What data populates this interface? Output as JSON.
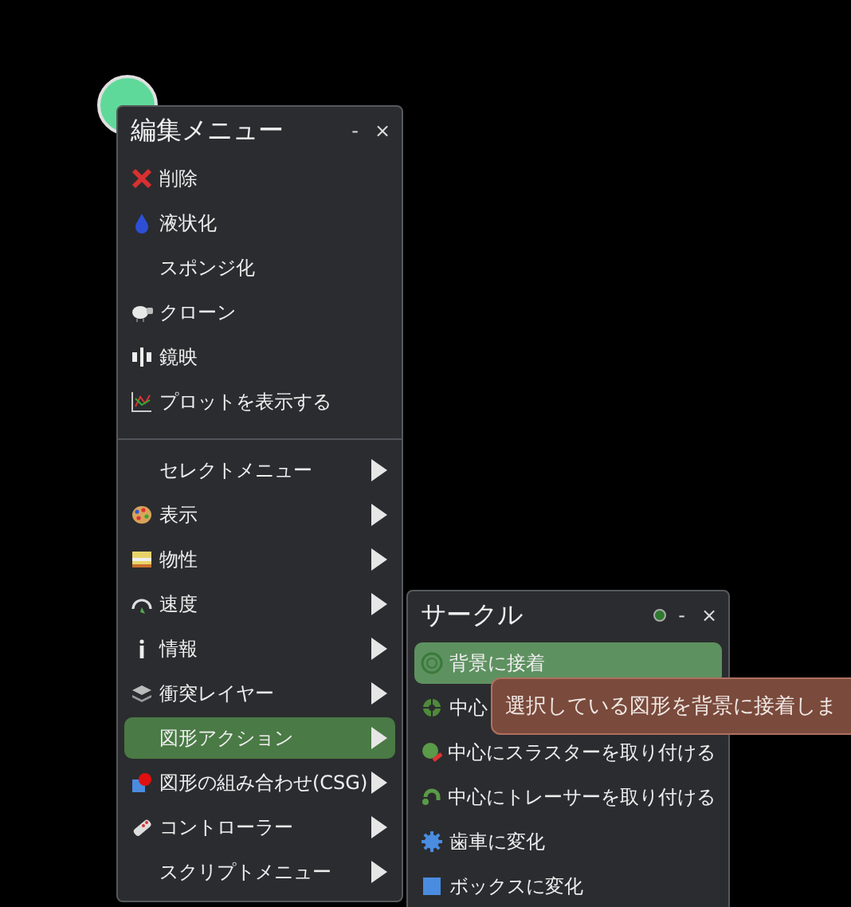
{
  "edit_menu": {
    "title": "編集メニュー",
    "title_buttons": [
      "-",
      "×"
    ],
    "items": [
      {
        "kind": "action",
        "label": "削除",
        "selected": false
      },
      {
        "kind": "action",
        "label": "液状化",
        "selected": false
      },
      {
        "kind": "action",
        "label": "スポンジ化",
        "selected": false
      },
      {
        "kind": "action",
        "label": "クローン",
        "selected": false
      },
      {
        "kind": "action",
        "label": "鏡映",
        "selected": false
      },
      {
        "kind": "action",
        "label": "プロットを表示する",
        "selected": false
      },
      {
        "kind": "separator"
      },
      {
        "kind": "submenu",
        "label": "セレクトメニュー",
        "selected": false
      },
      {
        "kind": "submenu",
        "label": "表示",
        "selected": false
      },
      {
        "kind": "submenu",
        "label": "物性",
        "selected": false
      },
      {
        "kind": "submenu",
        "label": "速度",
        "selected": false
      },
      {
        "kind": "submenu",
        "label": "情報",
        "selected": false
      },
      {
        "kind": "submenu",
        "label": "衝突レイヤー",
        "selected": false
      },
      {
        "kind": "submenu",
        "label": "図形アクション",
        "selected": true
      },
      {
        "kind": "submenu",
        "label": "図形の組み合わせ(CSG)",
        "selected": false
      },
      {
        "kind": "submenu",
        "label": "コントローラー",
        "selected": false
      },
      {
        "kind": "submenu",
        "label": "スクリプトメニュー",
        "selected": false
      }
    ]
  },
  "circle_menu": {
    "title": "サークル",
    "title_buttons": [
      "-",
      "×"
    ],
    "items": [
      {
        "kind": "action",
        "label": "背景に接着",
        "selected": true
      },
      {
        "kind": "action",
        "label": "中心",
        "selected": false
      },
      {
        "kind": "action",
        "label": "中心にスラスターを取り付ける",
        "selected": false
      },
      {
        "kind": "action",
        "label": "中心にトレーサーを取り付ける",
        "selected": false
      },
      {
        "kind": "action",
        "label": "歯車に変化",
        "selected": false
      },
      {
        "kind": "action",
        "label": "ボックスに変化",
        "selected": false
      }
    ]
  },
  "tooltip": {
    "text": "選択している図形を背景に接着しま"
  }
}
